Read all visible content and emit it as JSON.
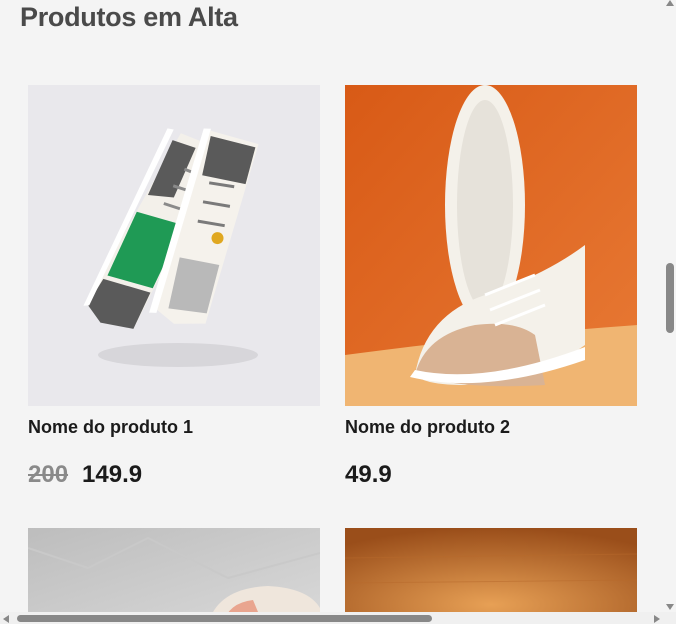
{
  "section": {
    "title": "Produtos em Alta"
  },
  "products": [
    {
      "name": "Nome do produto 1",
      "old_price": "200",
      "price": "149.9",
      "image": "green-white-grey-high-top-sneakers"
    },
    {
      "name": "Nome do produto 2",
      "old_price": "",
      "price": "49.9",
      "image": "white-beige-sneakers-orange-backdrop"
    },
    {
      "image": "sneaker-on-crumpled-paper"
    },
    {
      "image": "sneaker-on-wood-background"
    }
  ],
  "colors": {
    "accent_orange": "#e0691f",
    "sneaker_green": "#1f9a55"
  }
}
